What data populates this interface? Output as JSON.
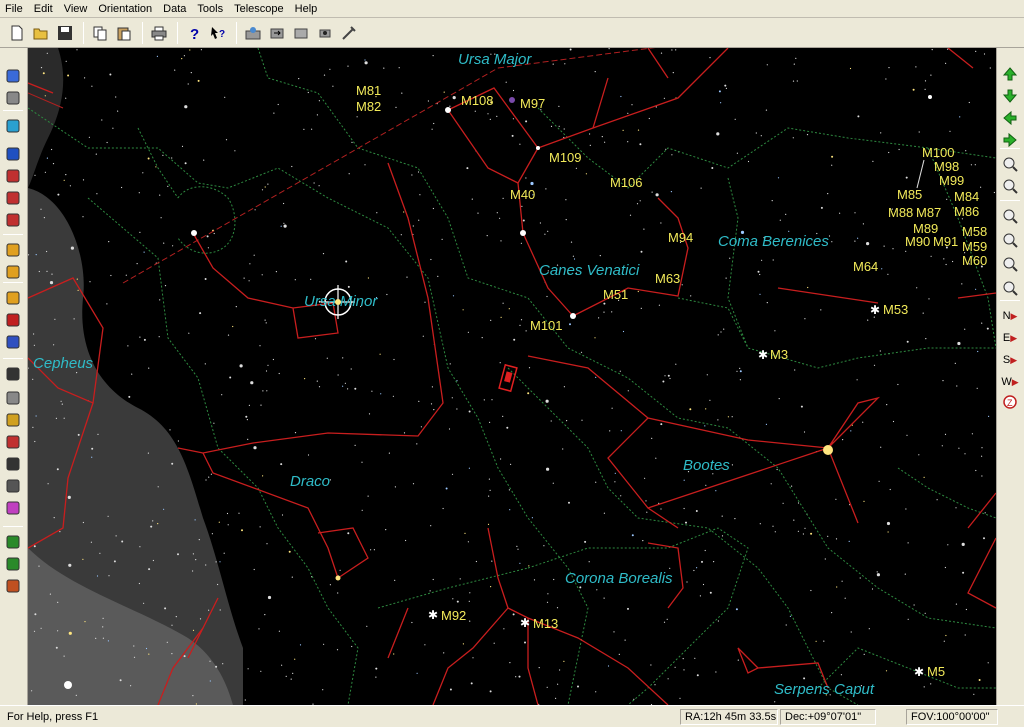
{
  "menu": [
    "File",
    "Edit",
    "View",
    "Orientation",
    "Data",
    "Tools",
    "Telescope",
    "Help"
  ],
  "toolbar_icons": [
    "new-icon",
    "open-icon",
    "save-icon",
    "copy-icon",
    "paste-icon",
    "print-icon",
    "help-icon",
    "context-help-icon",
    "telescope-connect-icon",
    "telescope-slew-icon",
    "telescope-sync-icon",
    "telescope-focus-icon",
    "telescope-park-icon"
  ],
  "left_toolbar_icons": [
    "equatorial-grid-icon",
    "horizon-icon",
    "daylight-icon",
    "planet-icon",
    "constellation-lines-icon",
    "constellation-boundaries-icon",
    "ecliptic-icon",
    "star-labels-icon",
    "deep-sky-labels-icon",
    "sun-icon",
    "comet-icon",
    "image-icon",
    "binoculars-icon",
    "star-icon",
    "double-star-icon",
    "variable-star-icon",
    "galaxy-icon",
    "cluster-icon",
    "nebula-icon",
    "asteroid-icon",
    "satellite-icon",
    "meteor-icon"
  ],
  "right_toolbar": {
    "arrows": [
      "arrow-up-icon",
      "arrow-down-icon",
      "arrow-left-icon",
      "arrow-right-icon"
    ],
    "zoom": [
      "zoom-in-icon",
      "zoom-out-icon",
      "rotate-icon",
      "horizon-flip-icon",
      "planetarium-icon",
      "zenith-icon"
    ],
    "directions": [
      "N",
      "E",
      "S",
      "W"
    ],
    "zenith_label": "Z"
  },
  "constellations": [
    "Ursa Major",
    "Ursa Minor",
    "Canes Venatici",
    "Coma Berenices",
    "Cepheus",
    "Draco",
    "Bootes",
    "Corona Borealis",
    "Serpens Caput"
  ],
  "messier": [
    "M81",
    "M82",
    "M108",
    "M97",
    "M109",
    "M40",
    "M106",
    "M94",
    "M63",
    "M51",
    "M101",
    "M64",
    "M53",
    "M3",
    "M100",
    "M98",
    "M99",
    "M85",
    "M84",
    "M88",
    "M87",
    "M86",
    "M89",
    "M58",
    "M90",
    "M91",
    "M59",
    "M60",
    "M92",
    "M13",
    "M5"
  ],
  "status": {
    "help": "For Help, press F1",
    "ra": "RA:12h 45m 33.5s",
    "dec": "Dec:+09°07'01\"",
    "fov": "FOV:100°00'00\""
  },
  "colors": {
    "constellation_lines": "#c81e1e",
    "boundaries": "#2e8a40",
    "labels_constellation": "#2fbcc8",
    "labels_messier": "#f2ea5a",
    "milky_way": "#6a6a6a"
  }
}
